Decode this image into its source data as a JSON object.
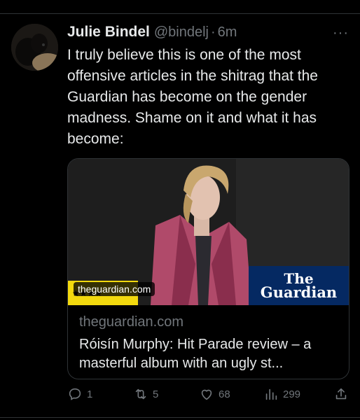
{
  "tweet": {
    "author_name": "Julie Bindel",
    "handle": "@bindelj",
    "separator": "·",
    "time": "6m",
    "more": "···",
    "text": "I truly believe this is one of the most offensive articles in the shitrag that the Guardian has become on the gender madness. Shame on it and what it has become:"
  },
  "card": {
    "image_domain_label": "theguardian.com",
    "logo_line1": "The",
    "logo_line2": "Guardian",
    "stars": "★★★★",
    "domain": "theguardian.com",
    "title": "Róisín Murphy: Hit Parade review – a masterful album with an ugly st..."
  },
  "actions": {
    "reply_count": "1",
    "retweet_count": "5",
    "like_count": "68",
    "views_count": "299"
  },
  "colors": {
    "background": "#000000",
    "text": "#e7e9ea",
    "muted": "#71767b",
    "guardian_blue": "#052962",
    "star_yellow": "#f2d90e"
  }
}
